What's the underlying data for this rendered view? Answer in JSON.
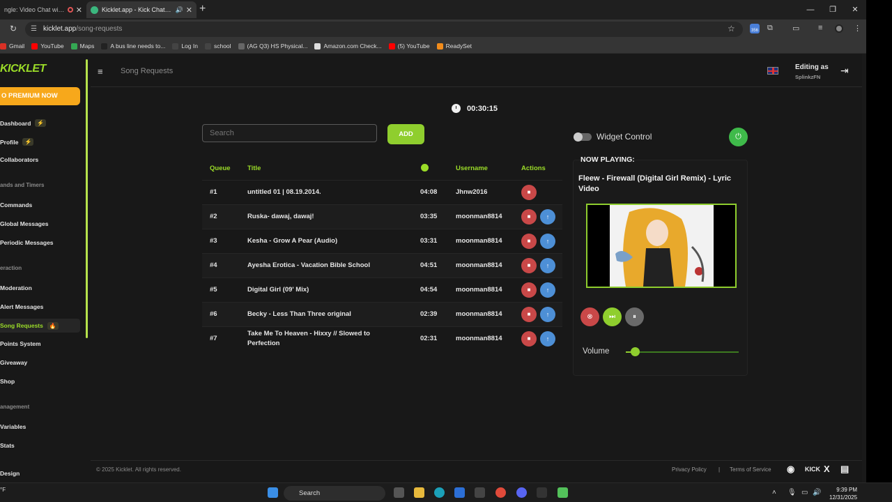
{
  "browser": {
    "tabs": [
      {
        "title": "ngle: Video Chat with S"
      },
      {
        "title": "Kicklet.app - Kick Chatbot a"
      }
    ],
    "url_host": "kicklet.app",
    "url_path": "/song-requests",
    "ext_badge": "356",
    "bookmarks": [
      {
        "label": "Gmail",
        "color": "#d93025"
      },
      {
        "label": "YouTube",
        "color": "#ff0000"
      },
      {
        "label": "Maps",
        "color": "#34a853"
      },
      {
        "label": "A bus line needs to...",
        "color": "#222222"
      },
      {
        "label": "Log In",
        "color": "#444444"
      },
      {
        "label": "school",
        "color": "#444444"
      },
      {
        "label": "(AG Q3) HS Physical...",
        "color": "#666666"
      },
      {
        "label": "Amazon.com Check...",
        "color": "#dddddd"
      },
      {
        "label": "(5) YouTube",
        "color": "#ff0000"
      },
      {
        "label": "ReadySet",
        "color": "#f28c1b"
      }
    ]
  },
  "sidebar": {
    "logo": "KICKLET",
    "premium": "O PREMIUM NOW",
    "items": [
      {
        "label": "Dashboard",
        "badge": "⚡",
        "type": "item"
      },
      {
        "label": "Profile",
        "badge": "⚡",
        "type": "item"
      },
      {
        "label": "Collaborators",
        "badge": "",
        "type": "item"
      },
      {
        "label": "ands and Timers",
        "badge": "",
        "type": "section"
      },
      {
        "label": "Commands",
        "badge": "",
        "type": "item"
      },
      {
        "label": "Global Messages",
        "badge": "",
        "type": "item"
      },
      {
        "label": "Periodic Messages",
        "badge": "",
        "type": "item"
      },
      {
        "label": "eraction",
        "badge": "",
        "type": "section"
      },
      {
        "label": "Moderation",
        "badge": "",
        "type": "item"
      },
      {
        "label": "Alert Messages",
        "badge": "",
        "type": "item"
      },
      {
        "label": "Song Requests",
        "badge": "🔥",
        "type": "active"
      },
      {
        "label": "Points System",
        "badge": "",
        "type": "item"
      },
      {
        "label": "Giveaway",
        "badge": "",
        "type": "item"
      },
      {
        "label": "Shop",
        "badge": "",
        "type": "item"
      },
      {
        "label": "anagement",
        "badge": "",
        "type": "section"
      },
      {
        "label": "Variables",
        "badge": "",
        "type": "item"
      },
      {
        "label": "Stats",
        "badge": "",
        "type": "item"
      },
      {
        "label": "Design",
        "badge": "",
        "type": "item"
      }
    ]
  },
  "header": {
    "title": "Song Requests",
    "editing_label": "Editing as",
    "editing_user": "SplinkzFN"
  },
  "timer": "00:30:15",
  "search": {
    "placeholder": "Search"
  },
  "add_label": "ADD",
  "queue": {
    "headers": {
      "queue": "Queue",
      "title": "Title",
      "username": "Username",
      "actions": "Actions"
    },
    "rows": [
      {
        "queue": "#1",
        "title": "untitled 01 | 08.19.2014.",
        "duration": "04:08",
        "user": "Jhnw2016",
        "upvote": false
      },
      {
        "queue": "#2",
        "title": "Ruska- dawaj, dawaj!",
        "duration": "03:35",
        "user": "moonman8814",
        "upvote": true
      },
      {
        "queue": "#3",
        "title": "Kesha - Grow A Pear (Audio)",
        "duration": "03:31",
        "user": "moonman8814",
        "upvote": true
      },
      {
        "queue": "#4",
        "title": "Ayesha Erotica - Vacation Bible School",
        "duration": "04:51",
        "user": "moonman8814",
        "upvote": true
      },
      {
        "queue": "#5",
        "title": "Digital Girl (09' Mix)",
        "duration": "04:54",
        "user": "moonman8814",
        "upvote": true
      },
      {
        "queue": "#6",
        "title": "Becky - Less Than Three original",
        "duration": "02:39",
        "user": "moonman8814",
        "upvote": true
      },
      {
        "queue": "#7",
        "title": "Take Me To Heaven - Hixxy // Slowed to Perfection",
        "duration": "02:31",
        "user": "moonman8814",
        "upvote": true
      }
    ]
  },
  "widget": {
    "label": "Widget Control",
    "enabled": false
  },
  "now_playing": {
    "label": "NOW PLAYING:",
    "title": "Fleew - Firewall (Digital Girl Remix) - Lyric Video",
    "volume_label": "Volume",
    "volume": 0.08
  },
  "footer": {
    "copyright": "© 2025 Kicklet. All rights reserved.",
    "privacy": "Privacy Policy",
    "sep": "|",
    "terms": "Terms of Service",
    "kick": "KICK",
    "x": "X"
  },
  "taskbar": {
    "search": "Search",
    "temp": "°F",
    "time": "9:39 PM",
    "date": "12/31/2025",
    "discord_badge": "99"
  },
  "colors": {
    "accent": "#8fce2e",
    "danger": "#c94848",
    "info": "#4d8fd6",
    "premium": "#f7a81b"
  }
}
